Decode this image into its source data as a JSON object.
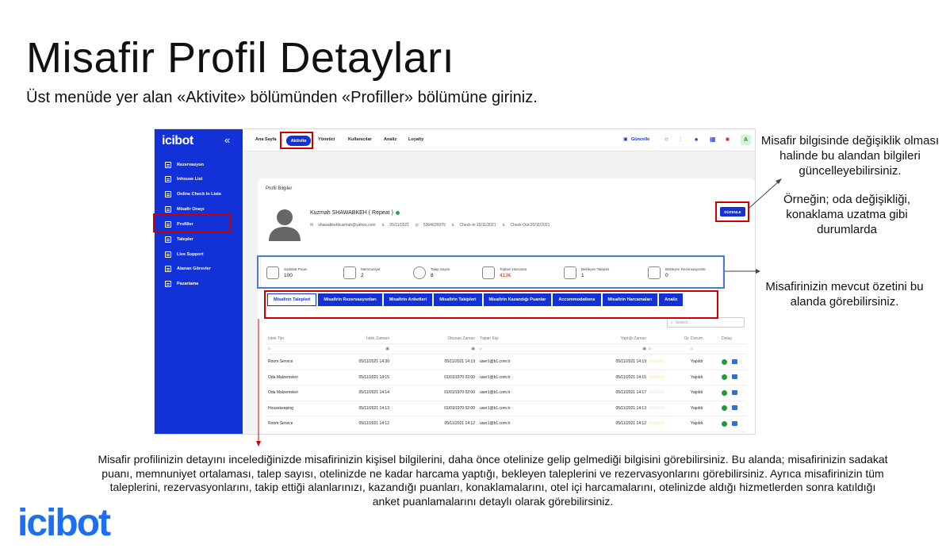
{
  "slide": {
    "title": "Misafir Profil Detayları",
    "subtitle": "Üst menüde yer alan «Aktivite» bölümünden «Profiller» bölümüne giriniz.",
    "note_update": "Misafir bilgisinde değişiklik olması halinde bu alandan bilgileri güncelleyebilirsiniz.",
    "note_example": "Örneğin; oda değişikliği, konaklama uzatma gibi durumlarda",
    "note_summary": "Misafirinizin mevcut özetini bu alanda görebilirsiniz.",
    "bottom_text": "Misafir profilinizin detayını incelediğinizde misafirinizin kişisel bilgilerini, daha önce otelinize gelip gelmediği bilgisini görebilirsiniz. Bu alanda; misafirinizin sadakat puanı, memnuniyet ortalaması, talep sayısı, otelinizde ne kadar harcama yaptığı, bekleyen taleplerini ve rezervasyonlarını görebilirsiniz. Ayrıca misafirinizin tüm taleplerini, rezervasyonlarını, takip ettiği alanlarınızı, kazandığı puanları, konaklamalarını, otel içi harcamalarını, otelinizde aldığı hizmetlerden sonra katıldığı anket puanlamalarını detaylı olarak görebilirsiniz.",
    "footer_logo": "icibot"
  },
  "app": {
    "logo": "icibot",
    "collapse": "«",
    "sidebar": [
      "Rezervasyon",
      "Inhouse List",
      "Online Check In Liste",
      "Misafir Onayı",
      "Profiller",
      "Talepler",
      "Live Support",
      "Atanan Görevler",
      "Pazarlama"
    ],
    "nav": {
      "home": "Ana Sayfa",
      "activity": "Aktivite",
      "manager": "Yönetici",
      "users": "Kullanıcılar",
      "analysis": "Analiz",
      "loyalty": "Loyalty",
      "update": "Güncelle",
      "avatar": "A"
    },
    "profile": {
      "card_title": "Profil Bilgiler",
      "name": "Kuzmah SHAWABKEH ( Repeat )",
      "email": "shawabkehkuzmah@yahoo.com",
      "birth": "05/11/2021",
      "phone": "5364626979",
      "checkin": "Check-In:15/11/2021",
      "checkout": "Check-Out:20/11/2021",
      "edit": "DÜZENLE"
    },
    "stats": [
      {
        "label": "Sadakat Puanı",
        "value": "100"
      },
      {
        "label": "Memnuniyet",
        "value": "2"
      },
      {
        "label": "Talep Sayısı",
        "value": "8"
      },
      {
        "label": "Toplam Harcama",
        "value": "413€"
      },
      {
        "label": "Bekleyen Talepler",
        "value": "1"
      },
      {
        "label": "Bekleyen Rezervasyonlar",
        "value": "0"
      }
    ],
    "tabs": [
      "Misafirin Talepleri",
      "Misafirin Rezervasyonları",
      "Misafirin Anketleri",
      "Misafirin Takipleri",
      "Misafirin Kazandığı Puanlar",
      "Accommodations",
      "Misafirin Harcamaları",
      "Analiz"
    ],
    "search_placeholder": "Search...",
    "table": {
      "headers": [
        "İstek Tipi",
        "İstek Zamanı",
        "Okunan Zaman",
        "Yapan Kişi",
        "Yaptığı Zaman",
        "Oy",
        "Durum",
        "Detay"
      ],
      "rows": [
        {
          "type": "Room Service",
          "req": "05/11/2021 14:30",
          "read": "05/11/2021 14:19",
          "by": "user1@b1.com.tr",
          "done": "05/11/2021 14:19",
          "status": "Yapıldı"
        },
        {
          "type": "Oda Malzemeleri",
          "req": "05/11/2021 14:15",
          "read": "01/01/1970 02:00",
          "by": "user1@b1.com.tr",
          "done": "05/11/2021 14:15",
          "status": "Yapıldı"
        },
        {
          "type": "Oda Malzemeleri",
          "req": "05/11/2021 14:14",
          "read": "01/01/1970 02:00",
          "by": "user1@b1.com.tr",
          "done": "05/11/2021 14:17",
          "status": "Yapıldı"
        },
        {
          "type": "Housekeeping",
          "req": "05/11/2021 14:13",
          "read": "01/01/1970 02:00",
          "by": "user1@b1.com.tr",
          "done": "05/11/2021 14:13",
          "status": "Yapıldı"
        },
        {
          "type": "Room Service",
          "req": "05/11/2021 14:12",
          "read": "05/11/2021 14:12",
          "by": "user1@b1.com.tr",
          "done": "05/11/2021 14:12",
          "status": "Yapıldı"
        }
      ],
      "stars": "☆☆☆☆☆"
    },
    "colors": {
      "primary": "#1232d8",
      "highlight_red": "#cc0000",
      "highlight_blue": "#4a7bd1",
      "logo_blue": "#1b6ff3"
    }
  }
}
